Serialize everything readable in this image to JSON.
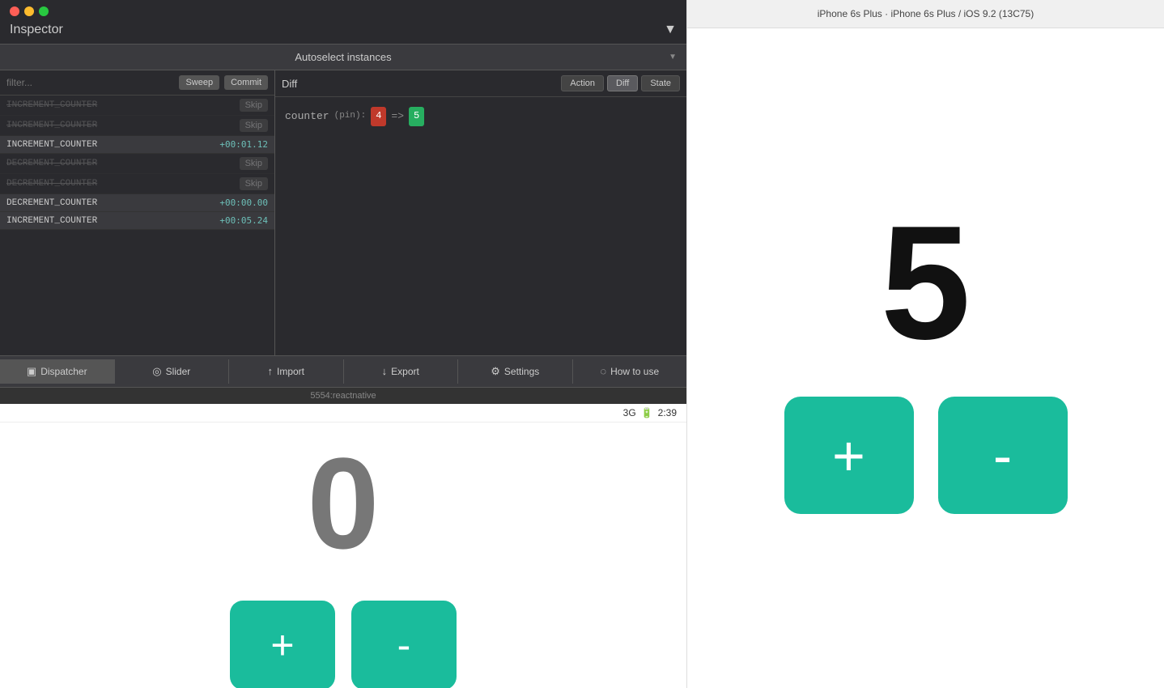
{
  "left_panel": {
    "traffic_lights": [
      "red",
      "yellow",
      "green"
    ],
    "inspector_title": "Inspector",
    "inspector_dropdown": "▼",
    "autoselect_title": "Autoselect instances",
    "autoselect_dropdown": "▼",
    "filter_placeholder": "filter...",
    "sweep_label": "Sweep",
    "commit_label": "Commit",
    "actions": [
      {
        "id": 1,
        "name": "INCREMENT_COUNTER",
        "state": "skipped",
        "value": null
      },
      {
        "id": 2,
        "name": "INCREMENT_COUNTER",
        "state": "skipped",
        "value": null
      },
      {
        "id": 3,
        "name": "INCREMENT_COUNTER",
        "state": "active",
        "value": "+00:01.12"
      },
      {
        "id": 4,
        "name": "DECREMENT_COUNTER",
        "state": "skipped",
        "value": null
      },
      {
        "id": 5,
        "name": "DECREMENT_COUNTER",
        "state": "skipped",
        "value": null
      },
      {
        "id": 6,
        "name": "DECREMENT_COUNTER",
        "state": "active",
        "value": "+00:00.00"
      },
      {
        "id": 7,
        "name": "INCREMENT_COUNTER",
        "state": "active",
        "value": "+00:05.24"
      }
    ],
    "skip_label": "Skip",
    "diff_label": "Diff",
    "tabs": [
      {
        "id": "action",
        "label": "Action",
        "active": false
      },
      {
        "id": "diff",
        "label": "Diff",
        "active": true
      },
      {
        "id": "state",
        "label": "State",
        "active": false
      }
    ],
    "diff_content": {
      "key": "counter",
      "pin": "(pin):",
      "old_value": "4",
      "arrow": "=>",
      "new_value": "5"
    },
    "toolbar": [
      {
        "id": "dispatcher",
        "icon": "▣",
        "label": "Dispatcher",
        "active": true
      },
      {
        "id": "slider",
        "icon": "◎",
        "label": "Slider",
        "active": false
      },
      {
        "id": "import",
        "icon": "↑",
        "label": "Import",
        "active": false
      },
      {
        "id": "export",
        "icon": "↓",
        "label": "Export",
        "active": false
      },
      {
        "id": "settings",
        "icon": "⚙",
        "label": "Settings",
        "active": false
      },
      {
        "id": "how-to-use",
        "icon": "◌",
        "label": "How to use",
        "active": false
      }
    ],
    "status_bar": "5554:reactnative",
    "emulator_counter": "0",
    "plus_label": "+",
    "minus_label": "-"
  },
  "phone_statusbar": {
    "signal": "3G",
    "battery_icon": "🔋",
    "time": "2:39"
  },
  "right_panel": {
    "title": "iPhone 6s Plus · iPhone 6s Plus / iOS 9.2 (13C75)",
    "counter_value": "5",
    "plus_label": "+",
    "minus_label": "-"
  },
  "colors": {
    "teal": "#1abc9c",
    "dark_bg": "#2a2a2e",
    "panel_bg": "#3a3a3e"
  }
}
